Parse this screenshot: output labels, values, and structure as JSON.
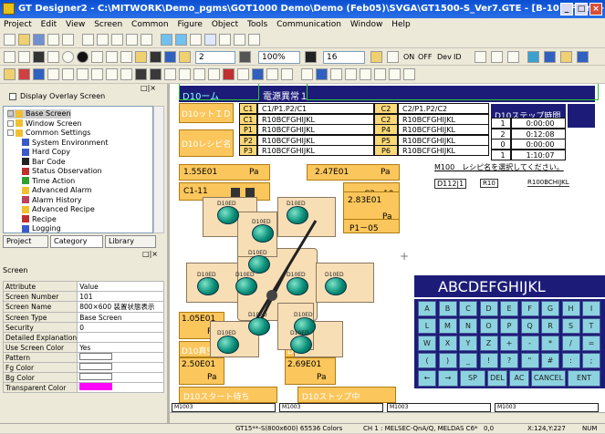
{
  "window": {
    "title": "GT Designer2 - C:\\MITWORK\\Demo_pgms\\GOT1000 Demo\\Demo (Feb05)\\SVGA\\GT1500-S_Ver7.GTE - [B-101(Front+Back):800×600 装置状態表示]"
  },
  "menu": [
    "Project",
    "Edit",
    "View",
    "Screen",
    "Common",
    "Figure",
    "Object",
    "Tools",
    "Communication",
    "Window",
    "Help"
  ],
  "toolbar": {
    "line_width": "2",
    "zoom": "100%",
    "font_size": "16",
    "on_label": "ON",
    "off_label": "OFF",
    "dev_label": "Dev",
    "id_label": "ID"
  },
  "left_pane": {
    "display_overlay": "Display Overlay Screen",
    "tree": [
      {
        "label": "Base Screen",
        "indent": 1,
        "icon": "#f0c030",
        "selected": true
      },
      {
        "label": "Window Screen",
        "indent": 1,
        "icon": "#f0c030",
        "selected": false
      },
      {
        "label": "Common Settings",
        "indent": 1,
        "icon": "#f0c030",
        "selected": false
      },
      {
        "label": "System Environment",
        "indent": 2,
        "icon": "#3a5ac8",
        "selected": false
      },
      {
        "label": "Hard Copy",
        "indent": 2,
        "icon": "#3a5ac8",
        "selected": false
      },
      {
        "label": "Bar Code",
        "indent": 2,
        "icon": "#222",
        "selected": false
      },
      {
        "label": "Status Observation",
        "indent": 2,
        "icon": "#c03030",
        "selected": false
      },
      {
        "label": "Time Action",
        "indent": 2,
        "icon": "#30a030",
        "selected": false
      },
      {
        "label": "Advanced Alarm",
        "indent": 2,
        "icon": "#f0c030",
        "selected": false
      },
      {
        "label": "Alarm History",
        "indent": 2,
        "icon": "#c04060",
        "selected": false
      },
      {
        "label": "Advanced Recipe",
        "indent": 2,
        "icon": "#f0c030",
        "selected": false
      },
      {
        "label": "Recipe",
        "indent": 2,
        "icon": "#c03030",
        "selected": false
      },
      {
        "label": "Logging",
        "indent": 2,
        "icon": "#3a5ac8",
        "selected": false
      }
    ],
    "tabs": [
      "Project",
      "Category",
      "Library"
    ],
    "screen_panel_title": "Screen",
    "prop_header": [
      "Attribute",
      "Value"
    ],
    "props": [
      [
        "Screen Number",
        "101"
      ],
      [
        "Screen Name",
        "800×600 装置状態表示"
      ],
      [
        "Screen Type",
        "Base Screen"
      ],
      [
        "Security",
        "0"
      ],
      [
        "Detailed Explanation",
        ""
      ],
      [
        "Use Screen Color",
        "Yes"
      ],
      [
        "Pattern",
        ""
      ],
      [
        "Fg Color",
        ""
      ],
      [
        "Bg Color",
        ""
      ],
      [
        "Transparent Color",
        ""
      ]
    ],
    "transparent_color": "#ff00ff"
  },
  "canvas": {
    "header_tag": "D10ーム",
    "header_title": "電源異常１",
    "left_labels": [
      "D10ットＩＤ",
      "D10レシピ名"
    ],
    "table": [
      [
        "C1",
        "C1/P1.P2/C1",
        "C2",
        "C2/P1.P2/C2"
      ],
      [
        "C1",
        "R10BCFGHIJKL",
        "C2",
        "R10BCFGHIJKL"
      ],
      [
        "P1",
        "R10BCFGHIJKL",
        "P4",
        "R10BCFGHIJKL"
      ],
      [
        "P2",
        "R10BCFGHIJKL",
        "P5",
        "R10BCFGHIJKL"
      ],
      [
        "P3",
        "R10BCFGHIJKL",
        "P6",
        "R10BCFGHIJKL"
      ]
    ],
    "step_header": "D10ステップ時間",
    "step_rows": [
      [
        "1",
        "0:00:00"
      ],
      [
        "2",
        "0:12:08"
      ],
      [
        "0",
        "0:00:00"
      ],
      [
        "1",
        "1:10:07"
      ]
    ],
    "message": "M100　レシピ名を選択してください。",
    "input_tag": "D112|1",
    "input_r": "R10",
    "input_val": "R100BCHIJKL",
    "readout_left": "1.55E01",
    "readout_left_unit": "Pa",
    "readout_center": "2.47E01",
    "readout_center_unit": "Pa",
    "channel_left": "C1-11",
    "channel_right": "C2－10",
    "readout_right": "2.83E01",
    "readout_right_unit": "Pa",
    "channel_right2": "P1－05",
    "left_box_1": "1.05E01",
    "left_box_1_unit": "Pa",
    "left_box_2_label": "D10真空",
    "left_box_2": "2.50E01",
    "left_box_2_unit": "Pa",
    "right_box_label": "D10大気",
    "right_box": "2.69E01",
    "right_box_unit": "Pa",
    "btn_wait": "D10スタート待ち",
    "btn_stop": "D10ストップ中",
    "ball_label": "D10ED",
    "kb_display": "ABCDEFGHIJKL",
    "kb_tag": "D1000",
    "kb_rows": [
      [
        "A",
        "B",
        "C",
        "D",
        "E",
        "F",
        "G",
        "H",
        "I"
      ],
      [
        "L",
        "M",
        "N",
        "O",
        "P",
        "Q",
        "R",
        "S",
        "T"
      ],
      [
        "W",
        "X",
        "Y",
        "Z",
        "+",
        "-",
        "*",
        "/",
        "="
      ],
      [
        "(",
        ")",
        "_",
        "!",
        "?",
        "\"",
        "#",
        ":",
        ";"
      ]
    ],
    "kb_bottom": [
      "←",
      "→",
      "SP",
      "DEL",
      "AC",
      "CANCEL",
      "ENT"
    ],
    "bottom_tags": [
      "M1003",
      "M1003",
      "M1003",
      "M1003"
    ],
    "cursor_mark": "+"
  },
  "status": {
    "model": "GT15**-S(800x600)  65536 Colors",
    "channel": "CH 1 : MELSEC-QnA/Q, MELDAS C6*",
    "offset": "0,0",
    "xy": "X:124,Y:227",
    "num": "NUM"
  }
}
